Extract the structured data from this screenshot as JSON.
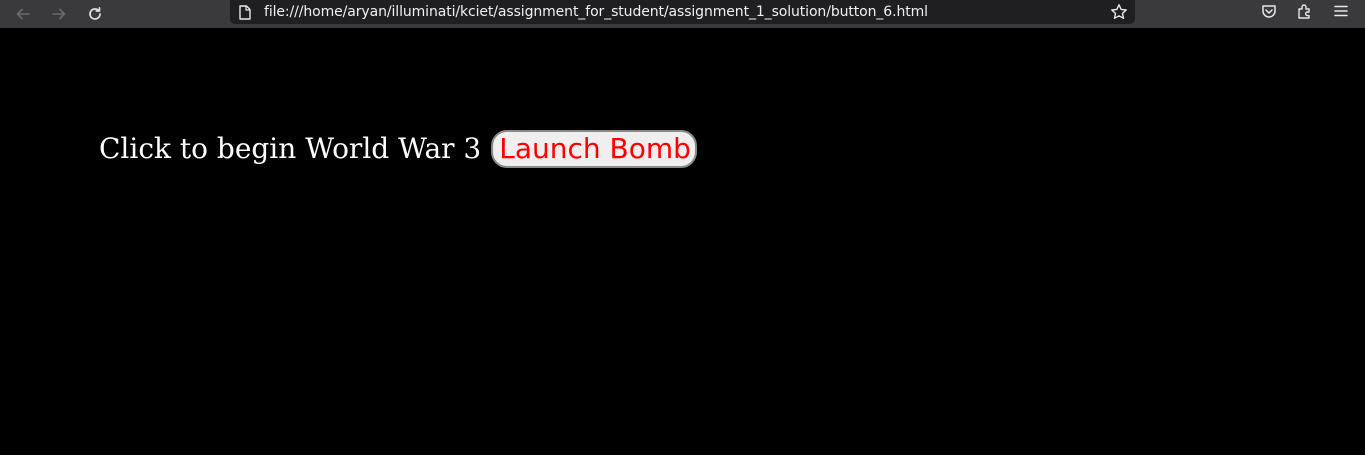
{
  "browser": {
    "url": "file:///home/aryan/illuminati/kciet/assignment_for_student/assignment_1_solution/button_6.html",
    "nav_icons": [
      "back-arrow-icon",
      "forward-arrow-icon",
      "reload-icon"
    ],
    "right_icons": [
      "pocket-icon",
      "extensions-icon",
      "menu-icon"
    ],
    "colors": {
      "toolbar": "#3a3a3c",
      "url_bar": "#1f1f21",
      "url_text": "#f0f0f0"
    }
  },
  "page": {
    "prompt": "Click to begin World War 3",
    "button_label": "Launch Bomb",
    "colors": {
      "background": "#000000",
      "prompt_text": "#ffffff",
      "button_text": "#ff0000",
      "button_bg": "#efefef"
    }
  }
}
